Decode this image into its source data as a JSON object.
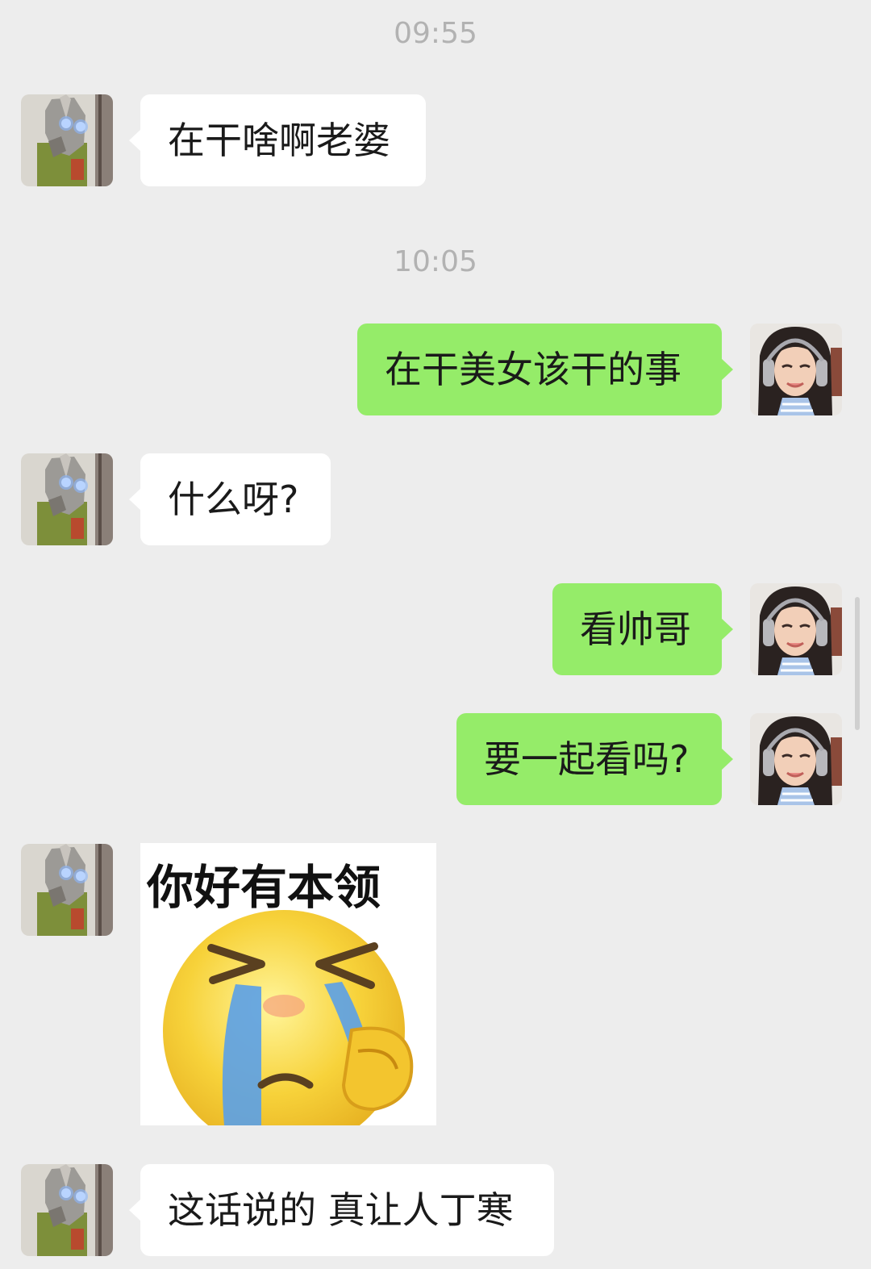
{
  "chat": {
    "timestamps": [
      "09:55",
      "10:05"
    ],
    "messages": [
      {
        "sender": "contact",
        "type": "text",
        "text": "在干啥啊老婆"
      },
      {
        "sender": "self",
        "type": "text",
        "text": "在干美女该干的事"
      },
      {
        "sender": "contact",
        "type": "text",
        "text": "什么呀?"
      },
      {
        "sender": "self",
        "type": "text",
        "text": "看帅哥"
      },
      {
        "sender": "self",
        "type": "text",
        "text": "要一起看吗?"
      },
      {
        "sender": "contact",
        "type": "sticker",
        "caption": "你好有本领",
        "image": "crying-emoji-sticker"
      },
      {
        "sender": "contact",
        "type": "text",
        "text": "这话说的 真让人丁寒"
      }
    ]
  },
  "colors": {
    "background": "#ededed",
    "incoming_bubble": "#ffffff",
    "outgoing_bubble": "#95ec69",
    "timestamp_text": "#b2b2b2"
  }
}
